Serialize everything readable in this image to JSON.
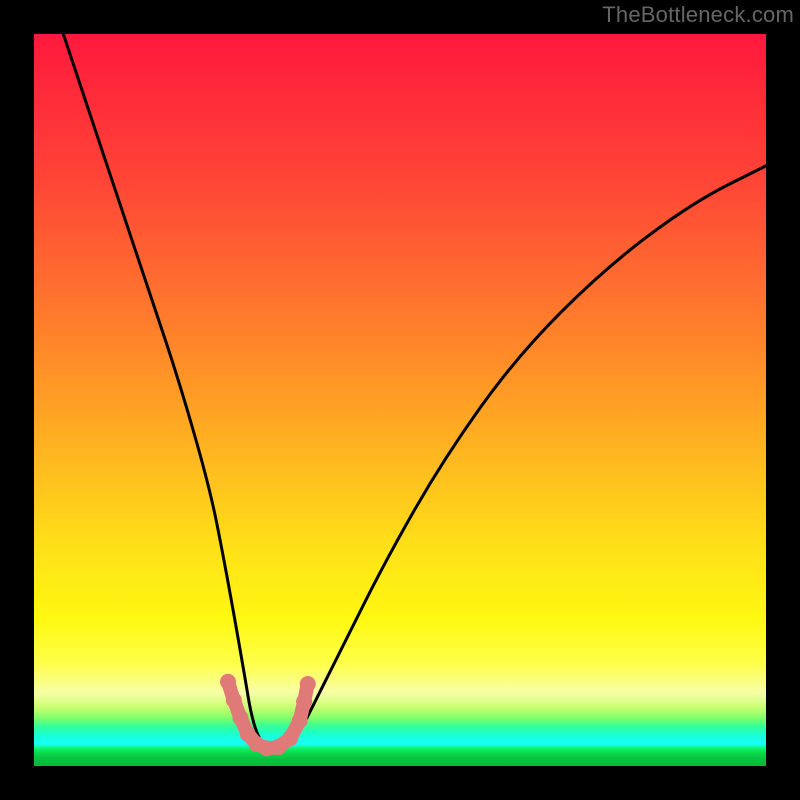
{
  "watermark": "TheBottleneck.com",
  "chart_data": {
    "type": "line",
    "title": "",
    "xlabel": "",
    "ylabel": "",
    "xlim": [
      0,
      100
    ],
    "ylim": [
      0,
      100
    ],
    "grid": false,
    "legend": false,
    "background": "vertical-rainbow-gradient",
    "series": [
      {
        "name": "black-curve",
        "stroke": "#000000",
        "x": [
          4,
          8,
          12,
          16,
          20,
          24,
          26,
          28.5,
          30,
          32,
          34,
          36,
          38,
          42,
          48,
          56,
          66,
          78,
          90,
          100
        ],
        "values": [
          100,
          88,
          76,
          64,
          52,
          38,
          28,
          14,
          5,
          2,
          2,
          4,
          8,
          16,
          28,
          42,
          56,
          68,
          77,
          82
        ]
      },
      {
        "name": "pink-beads",
        "stroke": "#e07a78",
        "marker": "circle",
        "x": [
          26.5,
          27.3,
          28.2,
          29.2,
          30.4,
          31.8,
          33.4,
          35.0,
          36.3,
          36.9,
          37.4
        ],
        "values": [
          11.5,
          9.0,
          6.6,
          4.4,
          3.0,
          2.4,
          2.6,
          3.8,
          6.2,
          8.8,
          11.2
        ]
      }
    ]
  }
}
